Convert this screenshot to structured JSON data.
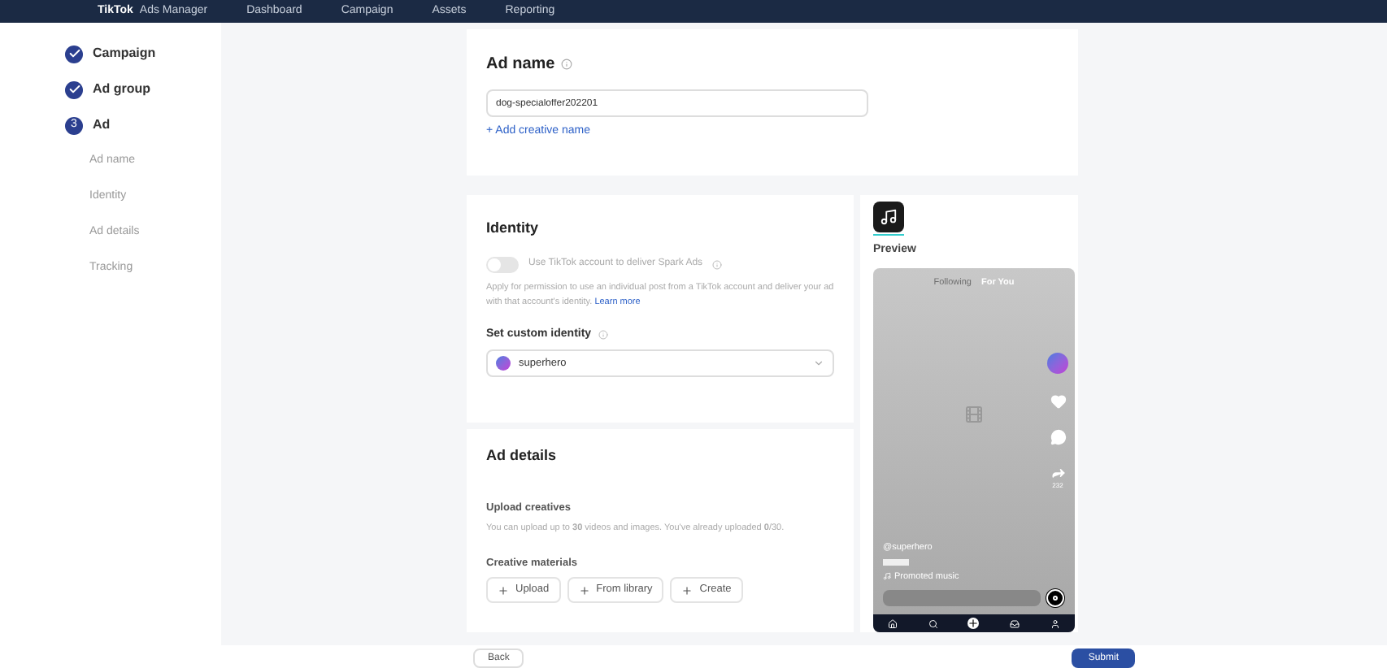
{
  "top_bar": {
    "logo": "TikTok",
    "product": "Ads Manager",
    "nav": [
      "Dashboard",
      "Campaign",
      "Assets",
      "Reporting"
    ]
  },
  "steps": [
    {
      "label": "Campaign",
      "kind": "done"
    },
    {
      "label": "Ad group",
      "kind": "done"
    },
    {
      "label": "Ad",
      "kind": "current",
      "marker": "3"
    }
  ],
  "sub_steps": [
    "Ad name",
    "Identity",
    "Ad details",
    "Tracking"
  ],
  "ad_name": {
    "title": "Ad name",
    "value": "dog-specialoffer202201",
    "add_link": "+ Add creative name"
  },
  "identity": {
    "title": "Identity",
    "spark_toggle": {
      "label": "Use TikTok account to deliver Spark Ads",
      "on": false
    },
    "description": "Apply for permission to use an individual post from a TikTok account and deliver your ad with that account's identity.",
    "learn_more": "Learn more",
    "custom_identity_label": "Set custom identity",
    "custom_identity_value": "superhero"
  },
  "preview": {
    "title": "Preview",
    "tabs": [
      {
        "label": "Following",
        "selected": false
      },
      {
        "label": "For You",
        "selected": true
      }
    ],
    "handle": "@superhero",
    "music": "Promoted music",
    "share_count": "232"
  },
  "ad_details": {
    "title": "Ad details",
    "upload_title": "Upload creatives",
    "upload_text": "You can upload up to **30** videos and images. You've already uploaded **0**/30.",
    "materials_title": "Creative materials",
    "buttons": [
      "Upload",
      "From library",
      "Create"
    ]
  },
  "footer": {
    "back": "Back",
    "submit": "Submit"
  }
}
